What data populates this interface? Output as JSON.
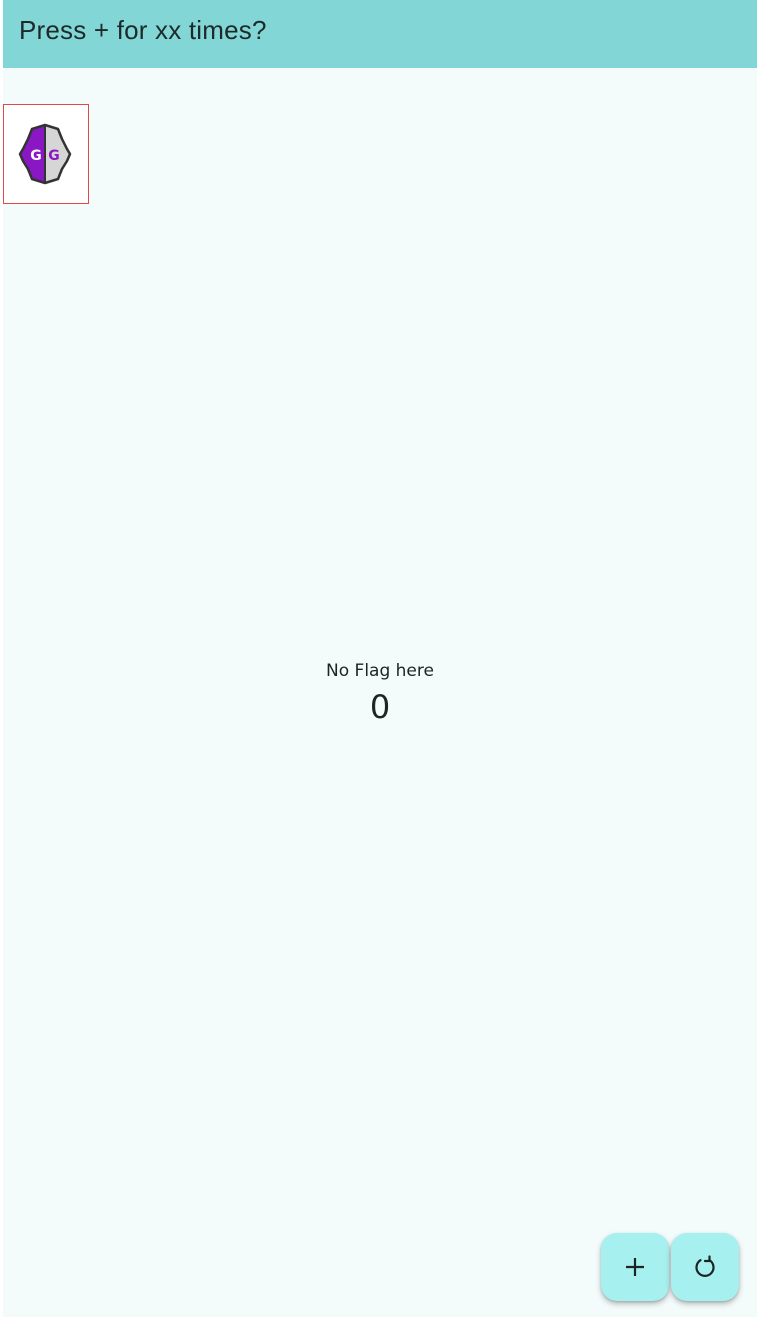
{
  "appbar": {
    "title": "Press + for xx times?",
    "background_color": "#83d6d6"
  },
  "logo": {
    "icon": "gameguardian-logo-icon",
    "letters": "GG",
    "accent_color": "#8a17c4",
    "border_color": "#e0484a"
  },
  "main": {
    "flag_text": "No Flag here",
    "counter": "0"
  },
  "fabs": [
    {
      "icon": "plus-icon",
      "background_color": "#a6f0f0"
    },
    {
      "icon": "reset-icon",
      "background_color": "#a6f0f0"
    }
  ]
}
